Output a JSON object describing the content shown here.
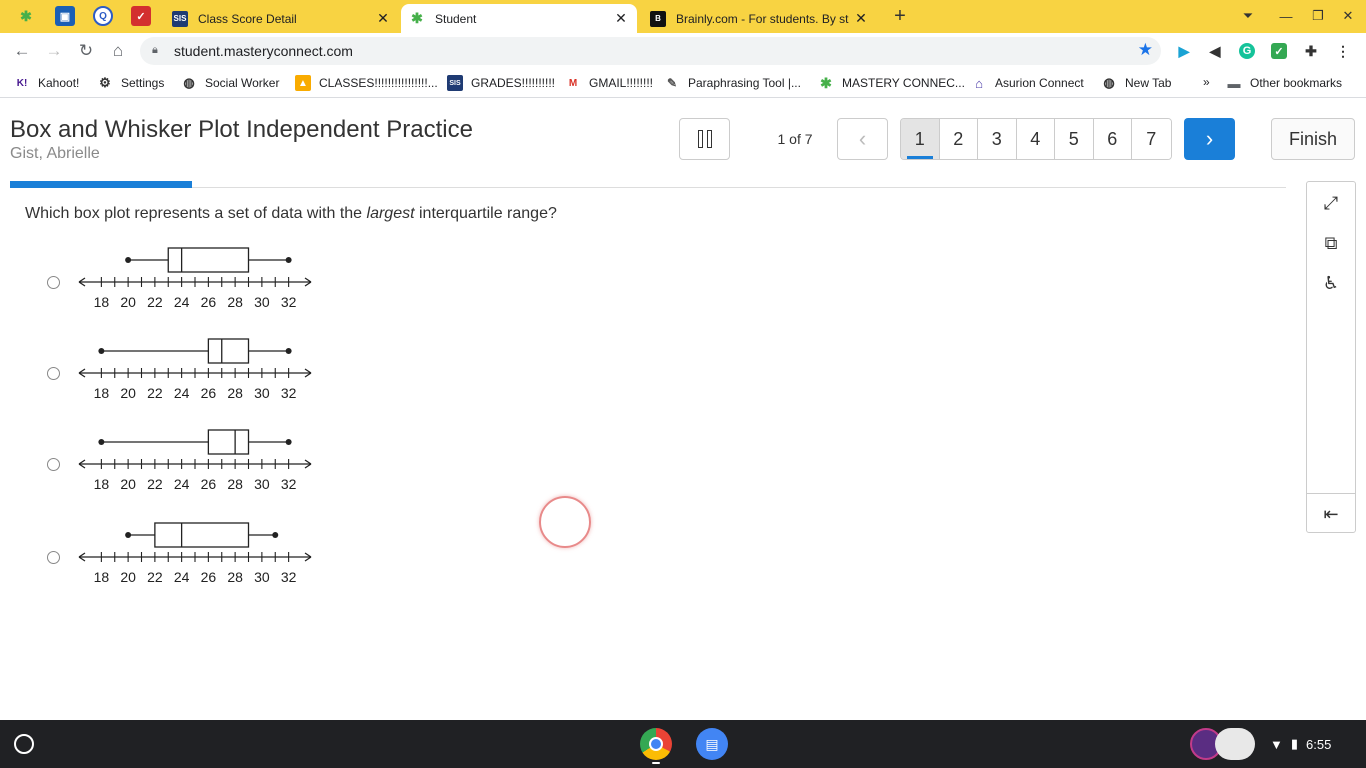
{
  "browser": {
    "tabs": [
      {
        "title": "Class Score Detail",
        "favicon": "SIS",
        "active": false
      },
      {
        "title": "Student",
        "favicon": "mastery",
        "active": true
      },
      {
        "title": "Brainly.com - For students. By st",
        "favicon": "B",
        "active": false
      }
    ],
    "new_tab_icon": "+",
    "url": "student.masteryconnect.com",
    "bookmarks": [
      {
        "label": "Kahoot!",
        "icon": "K!"
      },
      {
        "label": "Settings",
        "icon": "gear"
      },
      {
        "label": "Social Worker",
        "icon": "globe"
      },
      {
        "label": "CLASSES!!!!!!!!!!!!!!!!...",
        "icon": "classroom"
      },
      {
        "label": "GRADES!!!!!!!!!!",
        "icon": "SIS"
      },
      {
        "label": "GMAIL!!!!!!!!",
        "icon": "M"
      },
      {
        "label": "Paraphrasing Tool |...",
        "icon": "quill"
      },
      {
        "label": "MASTERY CONNEC...",
        "icon": "mastery"
      },
      {
        "label": "Asurion Connect",
        "icon": "asurion"
      },
      {
        "label": "New Tab",
        "icon": "globe"
      }
    ],
    "other_bookmarks": "Other bookmarks",
    "overflow": "»"
  },
  "assessment": {
    "title": "Box and Whisker Plot Independent Practice",
    "student": "Gist, Abrielle",
    "progress_label": "1 of 7",
    "progress_fraction": 0.143,
    "pages": [
      "1",
      "2",
      "3",
      "4",
      "5",
      "6",
      "7"
    ],
    "current_page": 1,
    "finish_label": "Finish"
  },
  "question": {
    "prefix": "Which box plot represents a set of data with the ",
    "emphasis": "largest",
    "suffix": " interquartile range?"
  },
  "chart_data": {
    "type": "box",
    "axis": {
      "min": 17,
      "max": 33,
      "tick_step": 1,
      "labels": [
        "18",
        "20",
        "22",
        "24",
        "26",
        "28",
        "30",
        "32"
      ]
    },
    "choices": [
      {
        "min": 20,
        "q1": 23,
        "median": 24,
        "q3": 29,
        "max": 32
      },
      {
        "min": 18,
        "q1": 26,
        "median": 27,
        "q3": 29,
        "max": 32
      },
      {
        "min": 18,
        "q1": 26,
        "median": 28,
        "q3": 29,
        "max": 32
      },
      {
        "min": 20,
        "q1": 22,
        "median": 24,
        "q3": 29,
        "max": 31
      }
    ]
  },
  "shelf": {
    "time": "6:55",
    "apps": [
      "chrome",
      "docs"
    ]
  }
}
